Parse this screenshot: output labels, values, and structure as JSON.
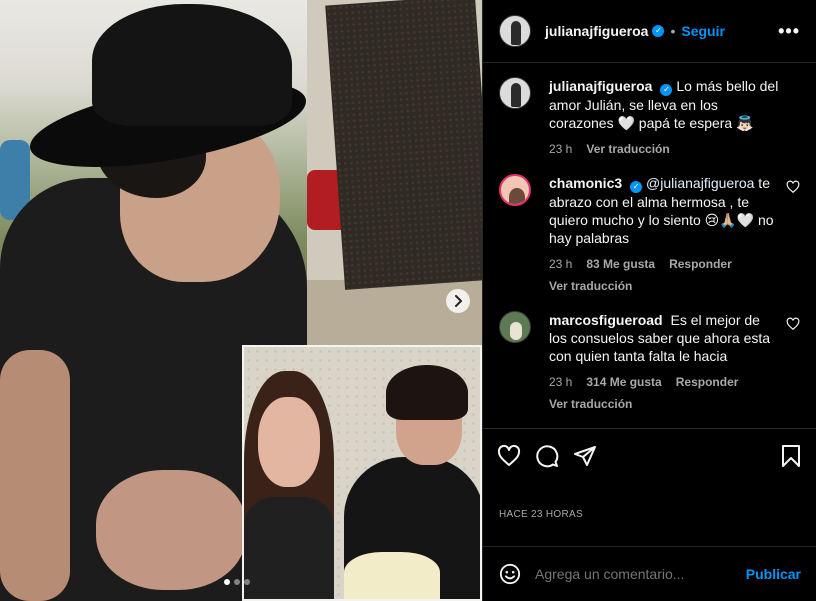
{
  "post": {
    "username": "julianajfigueroa",
    "follow_label": "Seguir",
    "separator": "•",
    "more_label": "•••",
    "carousel_dots": 3,
    "carousel_active": 0
  },
  "caption": {
    "username": "julianajfigueroa",
    "text": "Lo más bello del amor Julián, se lleva en los corazones 🤍 papá te espera 👼🏻",
    "time": "23 h",
    "translate": "Ver traducción"
  },
  "comments": [
    {
      "username": "chamonic3",
      "mention": "@julianajfigueroa",
      "text": " te abrazo con el alma hermosa , te quiero mucho y lo siento 😢🙏🏼🤍 no hay palabras",
      "time": "23 h",
      "likes": "83 Me gusta",
      "reply": "Responder",
      "translate": "Ver traducción"
    },
    {
      "username": "marcosfigueroad",
      "mention": "",
      "text": "Es el mejor de los consuelos saber que ahora esta con quien tanta falta le hacia",
      "time": "23 h",
      "likes": "314 Me gusta",
      "reply": "Responder",
      "translate": "Ver traducción"
    }
  ],
  "timestamp": "HACE 23 HORAS",
  "composer": {
    "placeholder": "Agrega un comentario...",
    "post_label": "Publicar"
  },
  "icons": {
    "like": "heart-icon",
    "comment": "comment-icon",
    "share": "share-icon",
    "save": "bookmark-icon",
    "emoji": "emoji-icon",
    "next": "chevron-right-icon"
  },
  "colors": {
    "accent": "#0095f6",
    "background": "#000000",
    "text": "#f5f5f5",
    "muted": "#a8a8a8",
    "divider": "#262626"
  }
}
